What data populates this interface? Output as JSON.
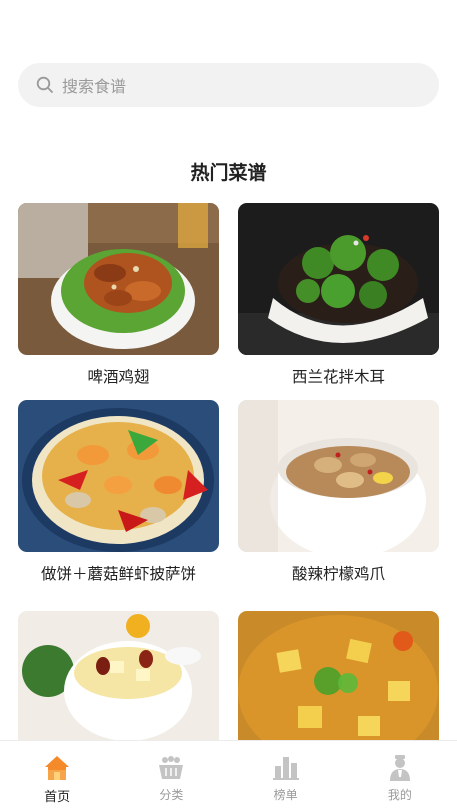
{
  "search": {
    "placeholder": "搜索食谱",
    "icon": "search-icon"
  },
  "section": {
    "title": "热门菜谱"
  },
  "recipes": [
    {
      "name": "啤酒鸡翅"
    },
    {
      "name": "西兰花拌木耳"
    },
    {
      "name": "做饼＋蘑菇鲜虾披萨饼"
    },
    {
      "name": "酸辣柠檬鸡爪"
    },
    {
      "name": ""
    },
    {
      "name": ""
    }
  ],
  "tabs": [
    {
      "label": "首页",
      "icon": "home-icon",
      "active": true
    },
    {
      "label": "分类",
      "icon": "basket-icon",
      "active": false
    },
    {
      "label": "榜单",
      "icon": "chart-icon",
      "active": false
    },
    {
      "label": "我的",
      "icon": "user-icon",
      "active": false
    }
  ],
  "colors": {
    "accent": "#f58a2a",
    "inactive": "#c4c4c4",
    "search_bg": "#f2f2f2",
    "highlight": "#fbe9a6"
  }
}
